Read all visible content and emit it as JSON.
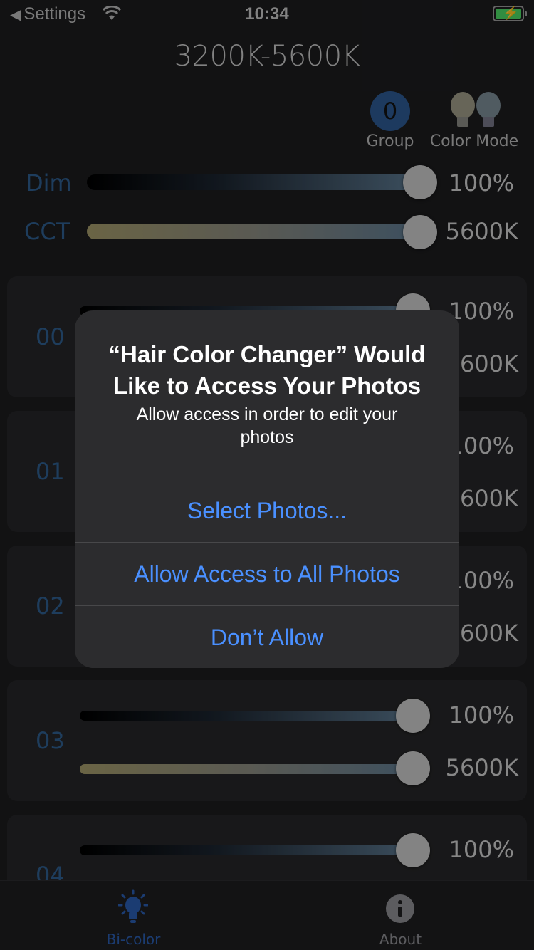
{
  "status_bar": {
    "back_label": "Settings",
    "time": "10:34"
  },
  "header": {
    "title": "3200K-5600K",
    "group_value": "0",
    "group_label": "Group",
    "color_mode_label": "Color Mode"
  },
  "master": {
    "dim_label": "Dim",
    "dim_value": "100%",
    "dim_level": 1.0,
    "cct_label": "CCT",
    "cct_value": "5600K",
    "cct_level": 1.0
  },
  "lights": [
    {
      "id": "00",
      "dim_value": "100%",
      "cct_value": "5600K"
    },
    {
      "id": "01",
      "dim_value": "100%",
      "cct_value": "5600K"
    },
    {
      "id": "02",
      "dim_value": "100%",
      "cct_value": "5600K"
    },
    {
      "id": "03",
      "dim_value": "100%",
      "cct_value": "5600K"
    },
    {
      "id": "04",
      "dim_value": "100%",
      "cct_value": ""
    }
  ],
  "alert": {
    "title": "“Hair Color Changer” Would Like to Access Your Photos",
    "message": "Allow access in order to edit your photos",
    "buttons": [
      "Select Photos...",
      "Allow Access to All Photos",
      "Don’t Allow"
    ]
  },
  "tabbar": {
    "tabs": [
      {
        "label": "Bi-color",
        "active": true
      },
      {
        "label": "About",
        "active": false
      }
    ]
  },
  "colors": {
    "accent_blue": "#2e5f90",
    "alert_button": "#4a90ff",
    "tab_active": "#2a5db0"
  }
}
